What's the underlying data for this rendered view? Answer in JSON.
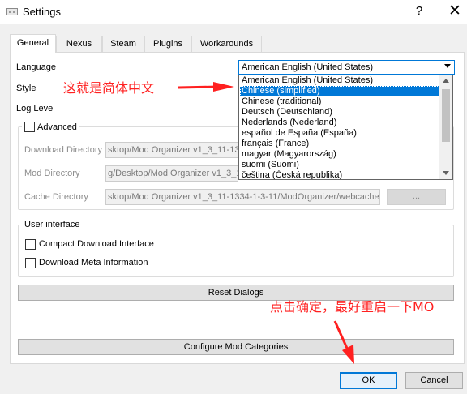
{
  "window": {
    "title": "Settings",
    "help_symbol": "?",
    "close_symbol": "✕"
  },
  "tabs": [
    {
      "label": "General",
      "active": true
    },
    {
      "label": "Nexus",
      "active": false
    },
    {
      "label": "Steam",
      "active": false
    },
    {
      "label": "Plugins",
      "active": false
    },
    {
      "label": "Workarounds",
      "active": false
    }
  ],
  "general": {
    "language_label": "Language",
    "style_label": "Style",
    "log_level_label": "Log Level",
    "language_selected": "American English (United States)",
    "language_options": [
      {
        "label": "American English (United States)",
        "highlighted": false
      },
      {
        "label": "Chinese (simplified)",
        "highlighted": true
      },
      {
        "label": "Chinese (traditional)",
        "highlighted": false
      },
      {
        "label": "Deutsch (Deutschland)",
        "highlighted": false
      },
      {
        "label": "Nederlands (Nederland)",
        "highlighted": false
      },
      {
        "label": "español de España (España)",
        "highlighted": false
      },
      {
        "label": "français (France)",
        "highlighted": false
      },
      {
        "label": "magyar (Magyarország)",
        "highlighted": false
      },
      {
        "label": "suomi (Suomi)",
        "highlighted": false
      },
      {
        "label": "čeština (Česká republika)",
        "highlighted": false
      }
    ],
    "advanced": {
      "label": "Advanced",
      "checked": false,
      "download_dir_label": "Download Directory",
      "download_dir_value": "sktop/Mod Organizer v1_3_11-133",
      "mod_dir_label": "Mod Directory",
      "mod_dir_value": "g/Desktop/Mod Organizer v1_3_1",
      "cache_dir_label": "Cache Directory",
      "cache_dir_value": "sktop/Mod Organizer v1_3_11-1334-1-3-11/ModOrganizer/webcache",
      "browse_label": "..."
    },
    "user_interface": {
      "group_label": "User interface",
      "compact_download_label": "Compact Download Interface",
      "compact_download_checked": false,
      "download_meta_label": "Download Meta Information",
      "download_meta_checked": false
    },
    "reset_dialogs_label": "Reset Dialogs",
    "configure_categories_label": "Configure Mod Categories"
  },
  "footer": {
    "ok_label": "OK",
    "cancel_label": "Cancel"
  },
  "annotations": {
    "chinese_note": "这就是简体中文",
    "ok_note": "点击确定，最好重启一下MO",
    "color": "#ff2020"
  },
  "colors": {
    "accent": "#0078d7",
    "window_bg": "#f0f0f0"
  }
}
